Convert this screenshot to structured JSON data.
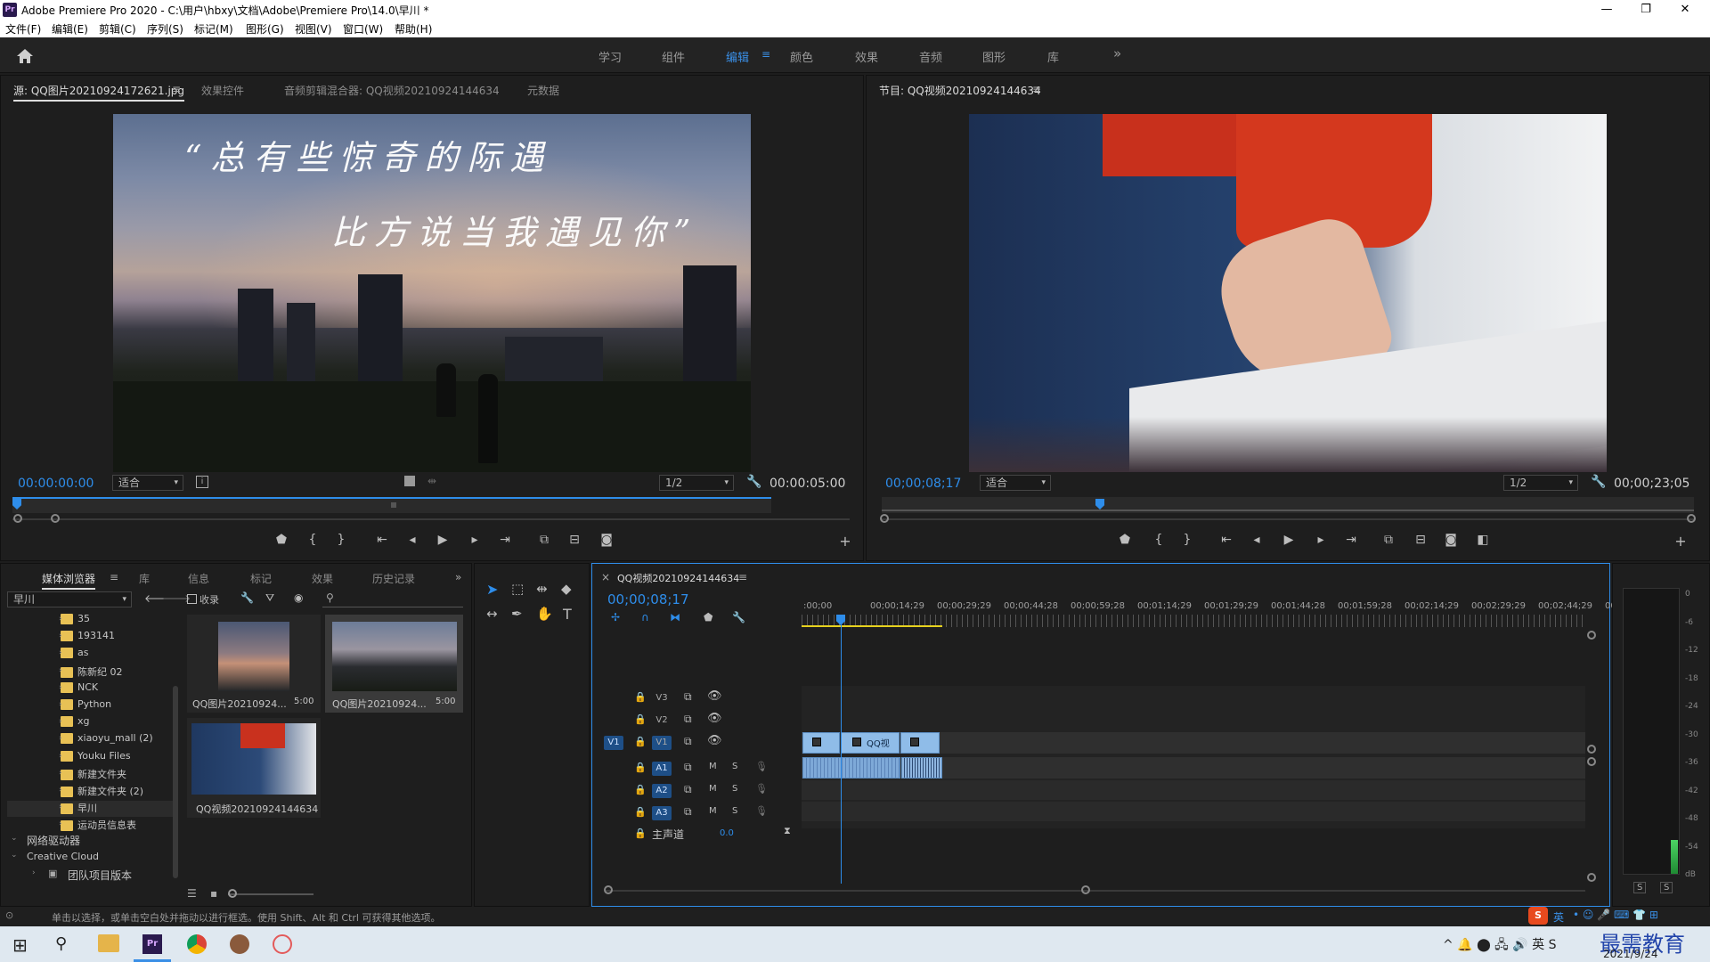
{
  "window": {
    "title": "Adobe Premiere Pro 2020 - C:\\用户\\hbxy\\文档\\Adobe\\Premiere Pro\\14.0\\早川 *",
    "logo": "Pr",
    "controls": [
      "—",
      "❐",
      "✕"
    ]
  },
  "menu": [
    "文件(F)",
    "编辑(E)",
    "剪辑(C)",
    "序列(S)",
    "标记(M)",
    "图形(G)",
    "视图(V)",
    "窗口(W)",
    "帮助(H)"
  ],
  "workspaces": {
    "items": [
      "学习",
      "组件",
      "编辑",
      "颜色",
      "效果",
      "音频",
      "图形",
      "库"
    ],
    "active": "编辑",
    "more": "»"
  },
  "source_panel": {
    "tabs": [
      "源: QQ图片20210924172621.jpg",
      "效果控件",
      "音频剪辑混合器: QQ视频20210924144634",
      "元数据"
    ],
    "timecode": "00:00:00:00",
    "fit": "适合",
    "resolution": "1/2",
    "duration": "00:00:05:00",
    "overlay_line1": "“总有些惊奇的际遇",
    "overlay_line2": "比方说当我遇见你”"
  },
  "program_panel": {
    "tab": "节目: QQ视频20210924144634",
    "timecode": "00;00;08;17",
    "fit": "适合",
    "resolution": "1/2",
    "duration": "00;00;23;05"
  },
  "project_panel": {
    "tabs": [
      "媒体浏览器",
      "库",
      "信息",
      "标记",
      "效果",
      "历史记录"
    ],
    "location": "早川",
    "ingest_label": "收录",
    "tree": [
      {
        "name": "35"
      },
      {
        "name": "193141"
      },
      {
        "name": "as"
      },
      {
        "name": "陈新纪 02"
      },
      {
        "name": "NCK"
      },
      {
        "name": "Python"
      },
      {
        "name": "xg"
      },
      {
        "name": "xiaoyu_mall (2)"
      },
      {
        "name": "Youku Files"
      },
      {
        "name": "新建文件夹"
      },
      {
        "name": "新建文件夹 (2)"
      },
      {
        "name": "早川"
      },
      {
        "name": "运动员信息表"
      }
    ],
    "network_drives": "网络驱动器",
    "creative_cloud": "Creative Cloud",
    "team_projects": "团队项目版本",
    "thumbs": [
      {
        "name": "QQ图片20210924...",
        "dur": "5:00"
      },
      {
        "name": "QQ图片20210924...",
        "dur": "5:00"
      },
      {
        "name": "QQ视频20210924144634",
        "dur": ""
      }
    ]
  },
  "timeline": {
    "sequence": "QQ视频20210924144634",
    "timecode": "00;00;08;17",
    "ruler": [
      ":00;00",
      "00;00;14;29",
      "00;00;29;29",
      "00;00;44;28",
      "00;00;59;28",
      "00;01;14;29",
      "00;01;29;29",
      "00;01;44;28",
      "00;01;59;28",
      "00;02;14;29",
      "00;02;29;29",
      "00;02;44;29",
      "00"
    ],
    "video_tracks": [
      "V3",
      "V2",
      "V1"
    ],
    "audio_tracks": [
      "A1",
      "A2",
      "A3"
    ],
    "source_patch_v": "V1",
    "mute": "M",
    "solo": "S",
    "master": "主声道",
    "master_value": "0.0",
    "clip_label": "QQ视"
  },
  "meter": {
    "scale": [
      "0",
      "-6",
      "-12",
      "-18",
      "-24",
      "-30",
      "-36",
      "-42",
      "-48",
      "-54",
      "dB"
    ],
    "solo": [
      "S",
      "S"
    ],
    "level": 0.12
  },
  "status": "单击以选择，或单击空白处并拖动以进行框选。使用 Shift、Alt 和 Ctrl 可获得其他选项。",
  "ime": "英",
  "watermark": "最需教育",
  "date": "2021/9/24",
  "colors": {
    "accent": "#2e8dea",
    "clip_video": "#8fbce8",
    "clip_audio": "#7ea9d8",
    "folder": "#e8c155"
  }
}
